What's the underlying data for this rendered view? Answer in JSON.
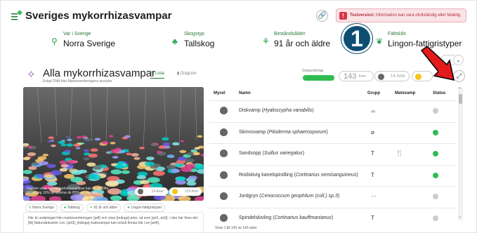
{
  "header": {
    "title": "Sveriges mykorrhizasvampar",
    "alert_label": "Testversion:",
    "alert_text": "Information kan vara ofullständig eller felaktig",
    "colors": {
      "alert": "#d9364a",
      "brand": "#1f7a36"
    }
  },
  "filters": [
    {
      "label": "Var i Sverige",
      "value": "Norra Sverige",
      "icon": "location-pin-icon"
    },
    {
      "label": "Skogstyp",
      "value": "Tallskog",
      "icon": "tree-icon"
    },
    {
      "label": "Beståndsålder",
      "value": "91 år och äldre",
      "icon": "age-icon"
    },
    {
      "label": "Fältskikt",
      "value": "Lingon-fattigristyper",
      "icon": "plant-icon"
    }
  ],
  "section": {
    "title": "Alla mykorrhizasvampar",
    "subtitle": "Enligt DNA från Markinventeringens provytor",
    "tabs": [
      {
        "label": "Lista",
        "active": true
      },
      {
        "label": "Diagram",
        "active": false
      }
    ],
    "datum_label": "Dataunderlag",
    "count": "143",
    "count_unit": "Arter",
    "dark_pill_text": "14 Arter"
  },
  "image_panel": {
    "caption": "Figuren visar hur mykorrhizasvampar kan se ut. Ofta täcker sig 10% av arterna de 80% av marken.",
    "pill_dark": "14 Arter",
    "pill_yellow": "129 Arter"
  },
  "chips": [
    "Norra Sverige",
    "Tallskog",
    "91 år och äldre",
    "Lingon-fattigristyper"
  ],
  "description": "Här är underlaget från markinventeringen (pdf) och visar [många] arter, så som [art1, art2]. I den här finns det [fä] Naturvårdsarter t.ex. [art3], [många] matsvampar kan också finnas här t.ex [art4].",
  "table": {
    "headers": [
      "Mycel",
      "Namn",
      "Grupp",
      "Matsvamp",
      "Status"
    ],
    "rows": [
      {
        "common": "Diskvamp",
        "latin": "Hyaloscypha variabilis",
        "group": "⌓",
        "food": "",
        "status_color": "#cccccc"
      },
      {
        "common": "Skinnsvamp",
        "latin": "Piloderma sphaerosporum",
        "group": "⌀",
        "food": "",
        "status_color": "#2fbd52"
      },
      {
        "common": "Sandsopp",
        "latin": "Suillus variegatus",
        "group": "T",
        "food": "🍴",
        "status_color": "#2fbd52"
      },
      {
        "common": "Rodskivig kanelspindling",
        "latin": "Cortinarius semisanguineus",
        "group": "T",
        "food": "",
        "status_color": "#2fbd52"
      },
      {
        "common": "Jordgryn",
        "latin": "Cenococcum geophilum (coll.) sp.3",
        "group": "···",
        "food": "",
        "status_color": "#cccccc"
      },
      {
        "common": "Spindelskivling",
        "latin": "Cortinarius kauffmanianus",
        "group": "T",
        "food": "",
        "status_color": "#cccccc"
      }
    ],
    "footer": "Visar 1 till 143 av 143 arter"
  },
  "annotation": {
    "number": "1"
  }
}
